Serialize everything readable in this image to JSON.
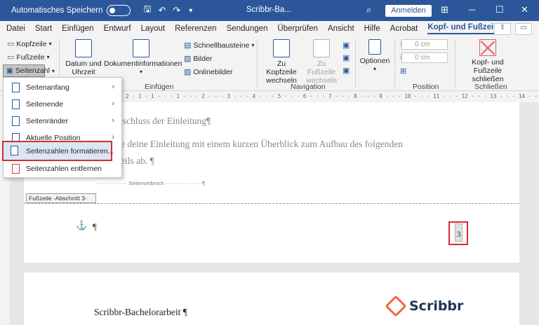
{
  "titlebar": {
    "autosave_label": "Automatisches Speichern",
    "doc_title": "Scribbr-Ba...",
    "signin_label": "Anmelden",
    "bg_color": "#2b579a",
    "icons": [
      "save-icon",
      "undo-icon",
      "redo-icon",
      "customize-icon",
      "search-icon",
      "display-options-icon",
      "minimize-icon",
      "maximize-icon",
      "close-icon"
    ]
  },
  "menubar": {
    "tabs": [
      "Datei",
      "Start",
      "Einfügen",
      "Entwurf",
      "Layout",
      "Referenzen",
      "Sendungen",
      "Überprüfen",
      "Ansicht",
      "Hilfe",
      "Acrobat",
      "Kopf- und Fußzeile"
    ],
    "active_tab": "Kopf- und Fußzeile"
  },
  "ribbon": {
    "kopfzeile": "Kopfzeile",
    "fusszeile": "Fußzeile",
    "seitenzahl": "Seitenzahl",
    "datum": "Datum und Uhrzeit",
    "dokumentinfo": "Dokumentinformationen",
    "schnellbausteine": "Schnellbausteine",
    "bilder": "Bilder",
    "onlinebilder": "Onlinebilder",
    "einfuegen_label": "Einfügen",
    "zu_kopfzeile": "Zu Kopfzeile wechseln",
    "zu_fusszeile": "Zu Fußzeile wechseln",
    "navigation_label": "Navigation",
    "optionen": "Optionen",
    "spin_top": "0 cm",
    "spin_bottom": "0 cm",
    "position_label": "Position",
    "schliessen_btn": "Kopf- und Fußzeile schließen",
    "schliessen_label": "Schließen"
  },
  "ruler": {
    "text": "· 2 · 1 · 1 · · · 1 · · · 2 · · · 3 · · · 4 · · · 5 · · · 6 · · · 7 · · · 8 · · · 9 · · · 10 · · · 11 · · · 12 · · · 13 · · · 14 · · · 15 · · · 16 · · · 17 · · · 18 ·"
  },
  "dropdown": {
    "items": [
      {
        "label": "Seitenanfang",
        "has_arrow": true
      },
      {
        "label": "Seitenende",
        "has_arrow": true
      },
      {
        "label": "Seitenränder",
        "has_arrow": true
      },
      {
        "label": "Aktuelle Position",
        "has_arrow": true
      },
      {
        "label": "Seitenzahlen formatieren...",
        "has_arrow": false,
        "highlighted": true
      },
      {
        "label": "Seitenzahlen entfernen",
        "has_arrow": false
      }
    ]
  },
  "document": {
    "line1": "bschluss der Einleitung¶",
    "line2": "e deine Einleitung mit einem kurzen Überblick zum Aufbau des folgenden",
    "line3": "eils ab. ¶",
    "page_break": "Seitenumbruch",
    "footer_label": "Fußzeile -Abschnitt 3-",
    "pilcrow": "¶",
    "page_number": "3",
    "page2_title": "Scribbr-Bachelorarbeit ¶",
    "logo_text": "Scribbr",
    "logo_color": "#f06a35",
    "highlight_color": "#d62e2e"
  }
}
